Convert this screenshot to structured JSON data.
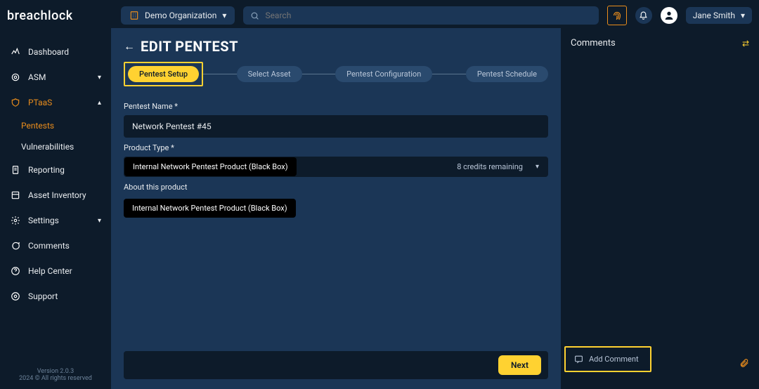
{
  "brand": "breachlock",
  "org_selector": {
    "label": "Demo Organization"
  },
  "search": {
    "placeholder": "Search"
  },
  "user": {
    "name": "Jane Smith"
  },
  "sidebar": {
    "items": [
      {
        "label": "Dashboard"
      },
      {
        "label": "ASM"
      },
      {
        "label": "PTaaS",
        "active": true
      },
      {
        "label": "Reporting"
      },
      {
        "label": "Asset Inventory"
      },
      {
        "label": "Settings"
      },
      {
        "label": "Comments"
      },
      {
        "label": "Help Center"
      },
      {
        "label": "Support"
      }
    ],
    "ptaas_children": [
      {
        "label": "Pentests",
        "active": true
      },
      {
        "label": "Vulnerabilities"
      }
    ],
    "footer": {
      "version": "Version 2.0.3",
      "copyright": "2024 © All rights reserved"
    }
  },
  "page": {
    "title": "EDIT PENTEST",
    "stepper": [
      {
        "label": "Pentest Setup",
        "active": true
      },
      {
        "label": "Select Asset"
      },
      {
        "label": "Pentest Configuration"
      },
      {
        "label": "Pentest Schedule"
      }
    ],
    "fields": {
      "name_label": "Pentest Name *",
      "name_value": "Network Pentest #45",
      "product_label": "Product Type *",
      "product_value": "Internal Network Pentest Product (Black Box)",
      "credits": "8 credits remaining",
      "about_label": "About this product",
      "about_value": "Internal Network Pentest Product (Black Box)"
    },
    "next_label": "Next"
  },
  "comments": {
    "title": "Comments",
    "add_placeholder": "Add Comment"
  }
}
